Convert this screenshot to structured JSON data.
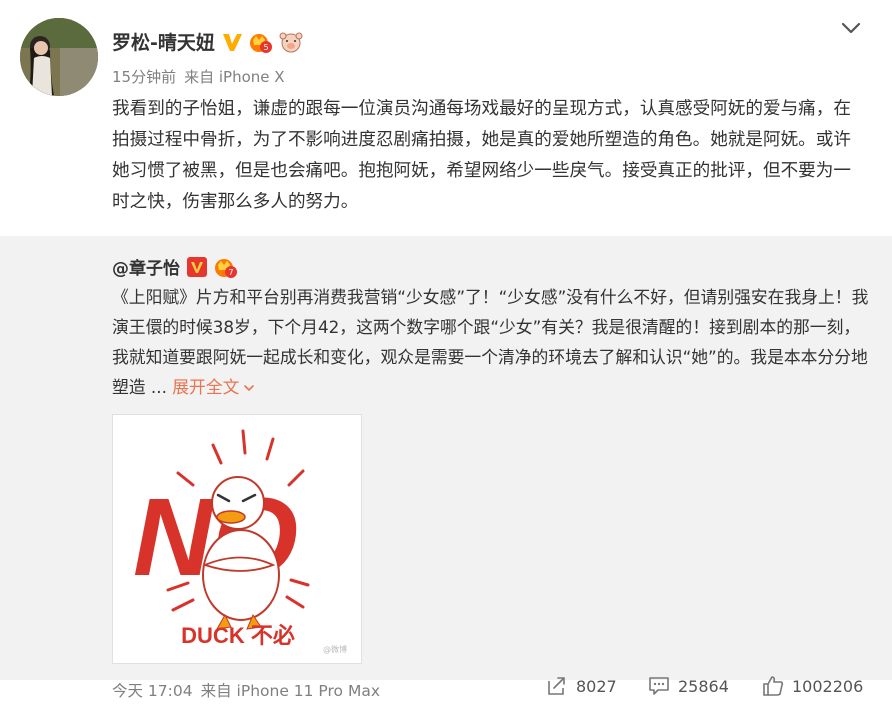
{
  "post": {
    "author": "罗松-晴天妞",
    "time": "15分钟前",
    "source": "来自 iPhone X",
    "text": "我看到的子怡姐，谦虚的跟每一位演员沟通每场戏最好的呈现方式，认真感受阿妩的爱与痛，在拍摄过程中骨折，为了不影响进度忍剧痛拍摄，她是真的爱她所塑造的角色。她就是阿妩。或许她习惯了被黑，但是也会痛吧。抱抱阿妩，希望网络少一些戾气。接受真正的批评，但不要为一时之快，伤害那么多人的努力。",
    "menu_icon": "chevron-down-icon",
    "badges": [
      "verified-v-icon",
      "vip-crown-icon",
      "emoji-pig-icon"
    ]
  },
  "repost": {
    "author": "@章子怡",
    "text": "《上阳赋》片方和平台别再消费我营销“少女感”了！“少女感”没有什么不好，但请别强安在我身上！我演王儇的时候38岁，下个月42，这两个数字哪个跟“少女”有关？我是很清醒的！接到剧本的那一刻，我就知道要跟阿妩一起成长和变化，观众是需要一个清净的环境去了解和认识“她”的。我是本本分分地塑造 ...",
    "expand_label": "展开全文",
    "image": {
      "no_text": "NO",
      "caption": "DUCK 不必",
      "watermark": "@微博"
    },
    "time": "今天 17:04",
    "source": "来自 iPhone 11 Pro Max",
    "stats": {
      "reposts": "8027",
      "comments": "25864",
      "likes": "1002206"
    }
  },
  "colors": {
    "accent": "#eb7350",
    "verified": "#ffab00",
    "repost_bg": "#f2f2f2",
    "meta_gray": "#808080",
    "no_red": "#d8332a"
  }
}
